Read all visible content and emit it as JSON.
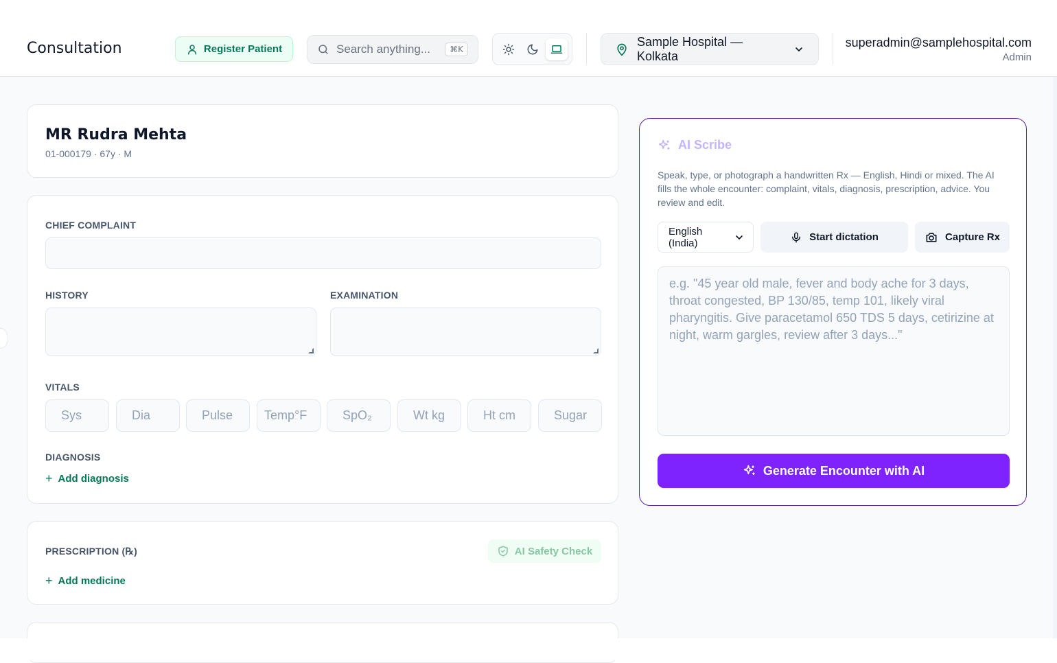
{
  "header": {
    "title": "Consultation",
    "register_label": "Register Patient",
    "search_placeholder": "Search anything...",
    "search_shortcut": "⌘K",
    "hospital": "Sample Hospital — Kolkata",
    "user_email": "superadmin@samplehospital.com",
    "user_role": "Admin",
    "theme_options": [
      "light-icon",
      "dark-icon",
      "system-icon"
    ],
    "active_theme": "system"
  },
  "patient": {
    "name": "MR Rudra Mehta",
    "meta": "01-000179 · 67y · M"
  },
  "clinical": {
    "chief_complaint_label": "CHIEF COMPLAINT",
    "history_label": "HISTORY",
    "examination_label": "EXAMINATION",
    "vitals_label": "VITALS",
    "vitals": [
      "Sys",
      "Dia",
      "Pulse",
      "Temp°F",
      "SpO₂",
      "Wt kg",
      "Ht cm",
      "Sugar"
    ],
    "diagnosis_label": "DIAGNOSIS",
    "add_diagnosis": "Add diagnosis"
  },
  "prescription": {
    "label": "PRESCRIPTION (℞)",
    "safety_check": "AI Safety Check",
    "add_medicine": "Add medicine"
  },
  "scribe": {
    "title": "AI Scribe",
    "description": "Speak, type, or photograph a handwritten Rx — English, Hindi or mixed. The AI fills the whole encounter: complaint, vitals, diagnosis, prescription, advice. You review and edit.",
    "language": "English (India)",
    "dictation_label": "Start dictation",
    "capture_label": "Capture Rx",
    "placeholder": "e.g. \"45 year old male, fever and body ache for 3 days, throat congested, BP 130/85, temp 101, likely viral pharyngitis. Give paracetamol 650 TDS 5 days, cetirizine at night, warm gargles, review after 3 days...\"",
    "generate_label": "Generate Encounter with AI"
  },
  "colors": {
    "accent_green": "#047857",
    "accent_purple": "#7e22fe",
    "scribe_border": "#5b21b6"
  }
}
